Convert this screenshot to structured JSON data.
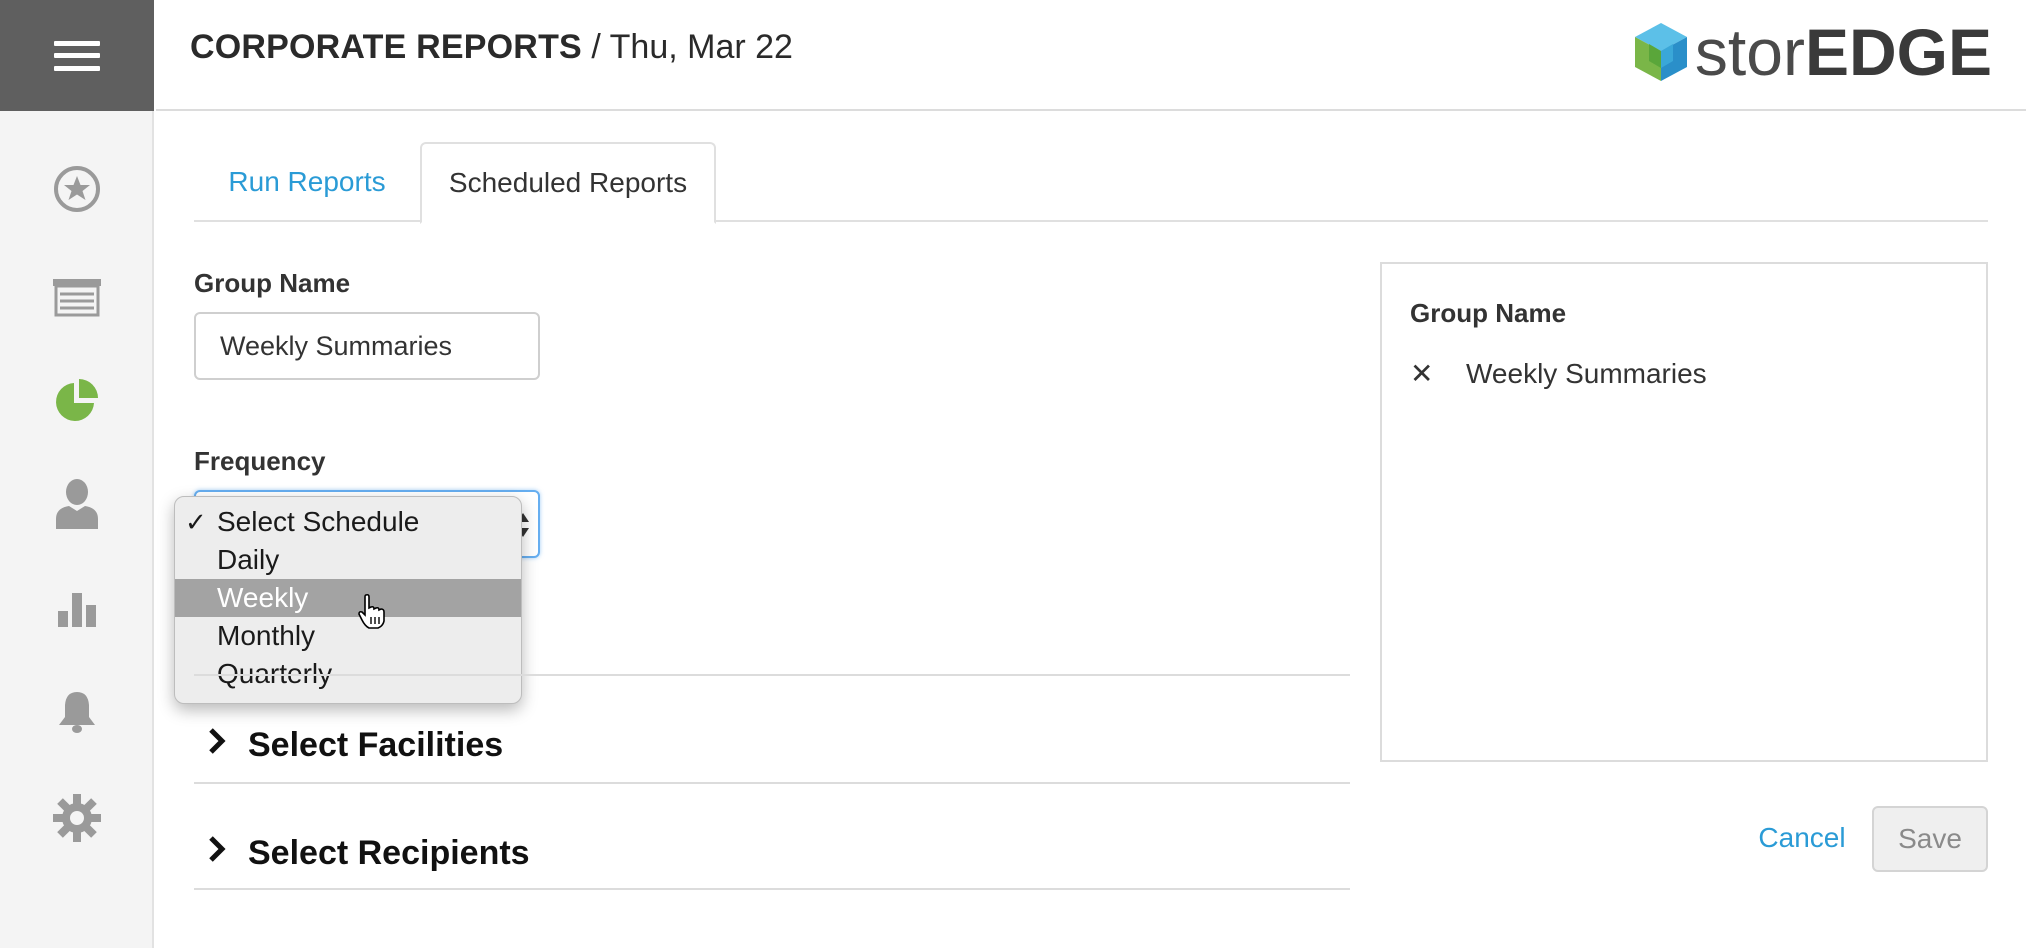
{
  "header": {
    "title_strong": "CORPORATE REPORTS",
    "title_light": "/ Thu, Mar 22",
    "logo_thin": "stor",
    "logo_bold": "EDGE"
  },
  "sidebar": {
    "items": [
      {
        "icon": "star-icon"
      },
      {
        "icon": "storage-unit-icon"
      },
      {
        "icon": "pie-chart-icon",
        "active": true,
        "color": "#7ab648"
      },
      {
        "icon": "user-icon"
      },
      {
        "icon": "bar-chart-icon"
      },
      {
        "icon": "bell-icon"
      },
      {
        "icon": "gear-icon"
      }
    ]
  },
  "tabs": [
    {
      "label": "Run Reports"
    },
    {
      "label": "Scheduled Reports",
      "active": true
    }
  ],
  "form": {
    "group_name_label": "Group Name",
    "group_name_value": "Weekly Summaries",
    "frequency_label": "Frequency",
    "frequency_options": [
      "Select Schedule",
      "Daily",
      "Weekly",
      "Monthly",
      "Quarterly"
    ],
    "frequency_checked": "Select Schedule",
    "frequency_highlighted": "Weekly",
    "check_mark": "✓"
  },
  "sections": [
    {
      "label": "Select Facilities"
    },
    {
      "label": "Select Recipients"
    }
  ],
  "summary_panel": {
    "title": "Group Name",
    "remove_symbol": "✕",
    "value": "Weekly Summaries"
  },
  "actions": {
    "cancel": "Cancel",
    "save": "Save"
  },
  "colors": {
    "accent_blue": "#2a9bd6",
    "active_green": "#7ab648",
    "sidebar_icon_gray": "#9a9a9a",
    "menu_bg": "#5f5f5f"
  }
}
